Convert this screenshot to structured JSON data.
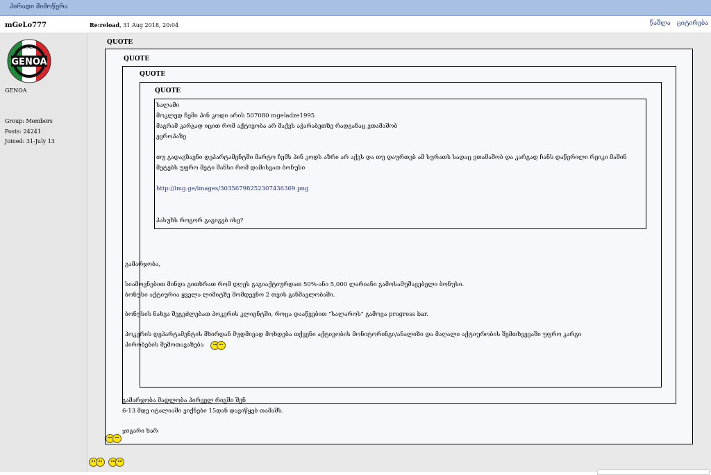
{
  "topbar": {
    "title": "პირადი მიმოწერა"
  },
  "post": {
    "author": "mGeLo777",
    "meta_prefix": "Re:reload",
    "meta_date": ", 31 Aug 2018, 20:04",
    "actions": [
      "წაშლა",
      "ციტირება"
    ]
  },
  "user": {
    "avatar_text_top": "ITALY",
    "avatar_text_main": "GENOA",
    "name_label": "GENOA",
    "group": "Group: Members",
    "posts": "Posts: 24241",
    "joined": "Joined: 31-July 13"
  },
  "quotes": {
    "q1": "QUOTE",
    "q2": "QUOTE",
    "q3": "QUOTE",
    "q4": "QUOTE"
  },
  "inner": {
    "l1": "სალამი",
    "l2": "მოკლედ ჩემი პინ კოდი არის 507080 mgeladze1995",
    "l3": "მაგრამ კარგად იცით რომ აქტივობა არ მაქვს აჭარაბეთზე რადგანაც ვთამაშობ",
    "l4": "ევროპაზე",
    "l5": "თუ გადაგზავნი დეპარტამენტში მარტო ჩემს პინ კოდს აზრი არ აქვს და თუ დაურთებ ამ სურათს სადაც ვთამაშობ და კარგად ჩანს დაწერილი რეიკი მაშინ",
    "l6": "მეტებს უფრო მეტი შანსი რომ დამისვათ ბონუსი",
    "link": "http://img.ge/images/30356798252307436369.png",
    "l7": "პასუხს როგორ გაგიგებ ისე?"
  },
  "level2": {
    "l1": "გამარჯობა,",
    "l2": "სიამოვნებით მინდა გითხრათ რომ დღეს გაგიაქტიურდათ 50%-ანი 5,000 ლარიანი გამოსამუშავებელი ბონუსი.",
    "l3": "ბონუსი აქტიურია ყველა ლიმიტზე მომდევნო 2 თვის განმავლობაში.",
    "l4": "ბონუსის ნახვა შეგეძლებათ პოკერის კლიენტში, როცა დააწვებით \"სალაროს\" გამოვა progress bar.",
    "l5": "პოკერის დეპარტამენტის მხირდან მუდმივად მოხდება თქვენი აქტივობის მონიტორინგი/ანალიზი და მაღალი აქტიურობის შემთხვევაში უფრო კარგი",
    "l6": "პირობების შემოთავაზება"
  },
  "level1": {
    "l1": "გამარჯობა მადლობა პირველ რიგში შენ",
    "l2": "6-13 მდე იტალიაში ვიქნები 15დან დავიწყებ თამაშს.",
    "l3": "ჯიგარი ხარ"
  },
  "colors": {
    "topbar": "#a8c0e4",
    "sidebar": "#e6e6e6",
    "link": "#1f2f7a"
  }
}
